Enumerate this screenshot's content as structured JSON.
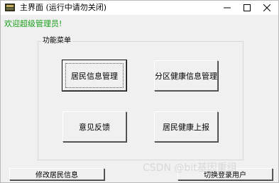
{
  "window": {
    "title": "主界面 (运行中请勿关闭)",
    "controls": {
      "minimize_icon": "minimize-icon",
      "maximize_icon": "maximize-icon",
      "close_icon": "close-icon"
    }
  },
  "welcome_text": "欢迎超级管理员!",
  "colors": {
    "welcome": "#1aa01a",
    "window_bg": "#f0f0f0",
    "watermark": "#d4d4d4"
  },
  "function_menu": {
    "title": "功能菜单",
    "buttons": {
      "resident_info": "居民信息管理",
      "zone_health": "分区健康信息管理",
      "feedback": "意见反馈",
      "health_report": "居民健康上报"
    }
  },
  "bottom": {
    "edit_resident": "修改居民信息",
    "exit": "切换登录用户"
  },
  "watermark": "CSDN @bit基因重组"
}
